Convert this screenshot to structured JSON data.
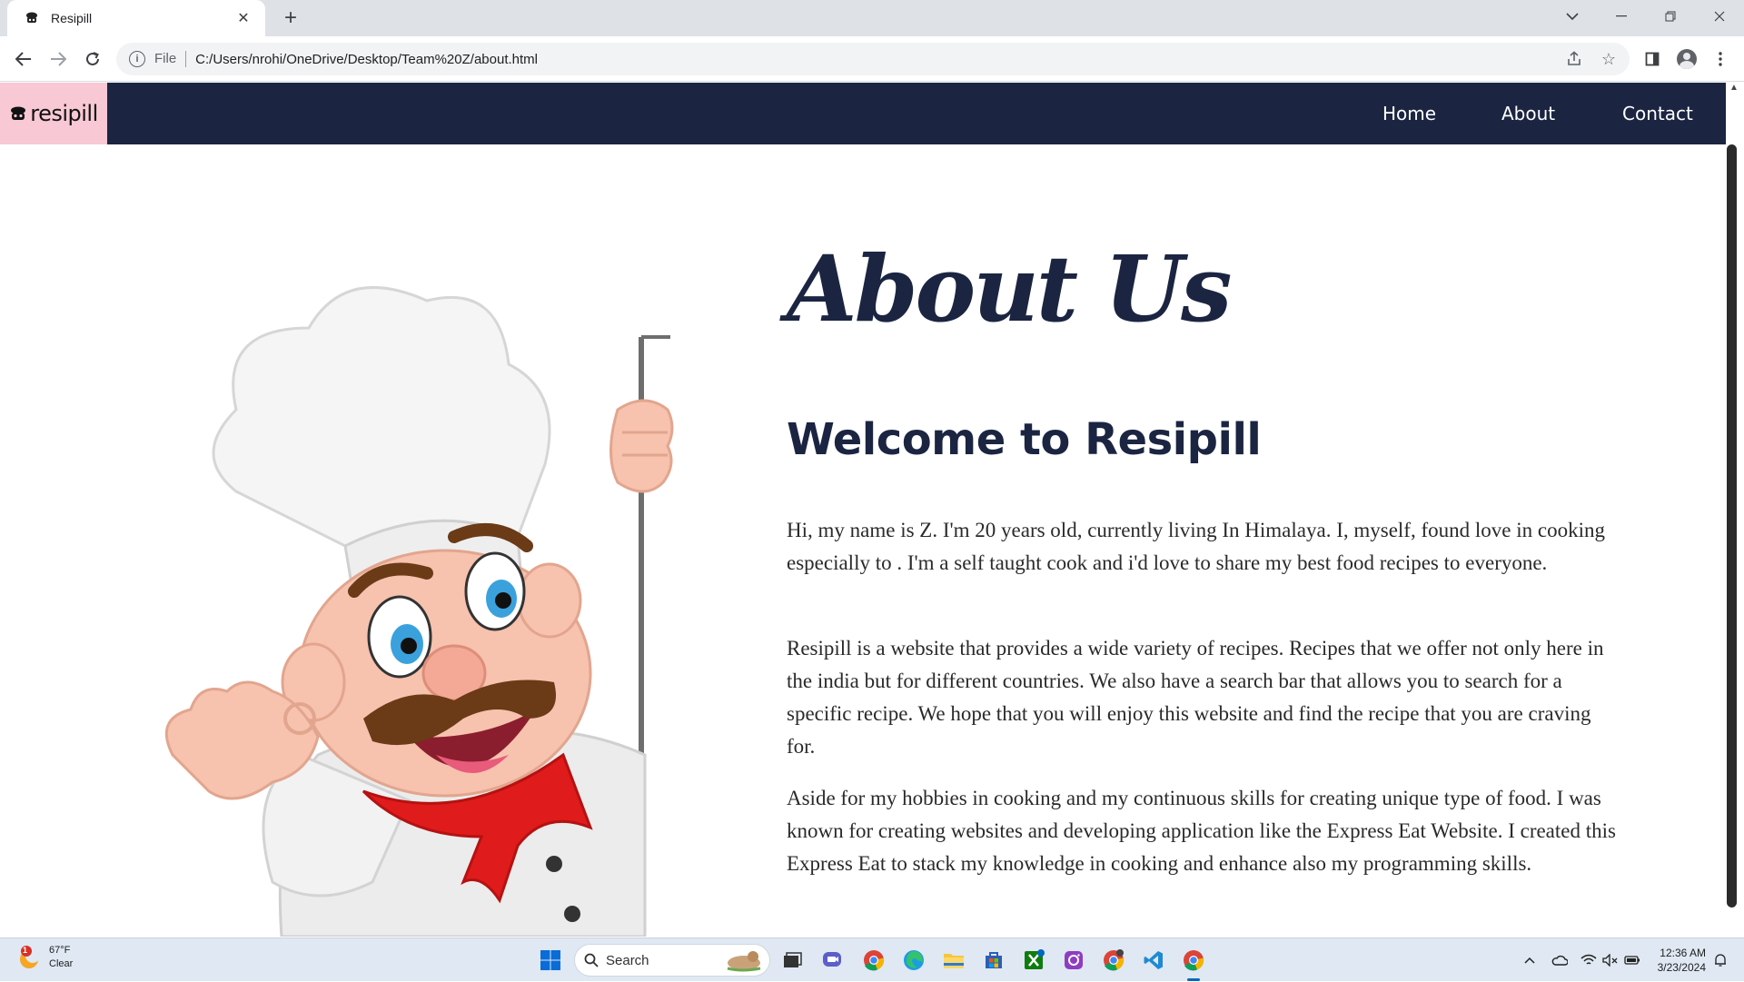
{
  "browser": {
    "tab_title": "Resipill",
    "url_scheme": "File",
    "url": "C:/Users/nrohi/OneDrive/Desktop/Team%20Z/about.html"
  },
  "site": {
    "brand": "resipill",
    "nav": [
      "Home",
      "About",
      "Contact"
    ],
    "heading": "About Us",
    "subheading": "Welcome to Resipill",
    "paragraphs": [
      "Hi, my name is Z. I'm 20 years old, currently living In Himalaya. I, myself, found love in cooking especially to . I'm a self taught cook and i'd love to share my best food recipes to everyone.",
      "Resipill is a website that provides a wide variety of recipes. Recipes that we offer not only here in the india but for different countries. We also have a search bar that allows you to search for a specific recipe. We hope that you will enjoy this website and find the recipe that you are craving for.",
      "Aside for my hobbies in cooking and my continuous skills for creating unique type of food. I was known for creating websites and developing application like the Express Eat Website. I created this Express Eat to stack my knowledge in cooking and enhance also my programming skills."
    ],
    "colors": {
      "nav_bg": "#1b2542",
      "brand_bg": "#f8c8d4",
      "heading": "#1b2542"
    }
  },
  "taskbar": {
    "weather_temp": "67°F",
    "weather_desc": "Clear",
    "weather_badge": "1",
    "search_placeholder": "Search",
    "time": "12:36 AM",
    "date": "3/23/2024"
  }
}
